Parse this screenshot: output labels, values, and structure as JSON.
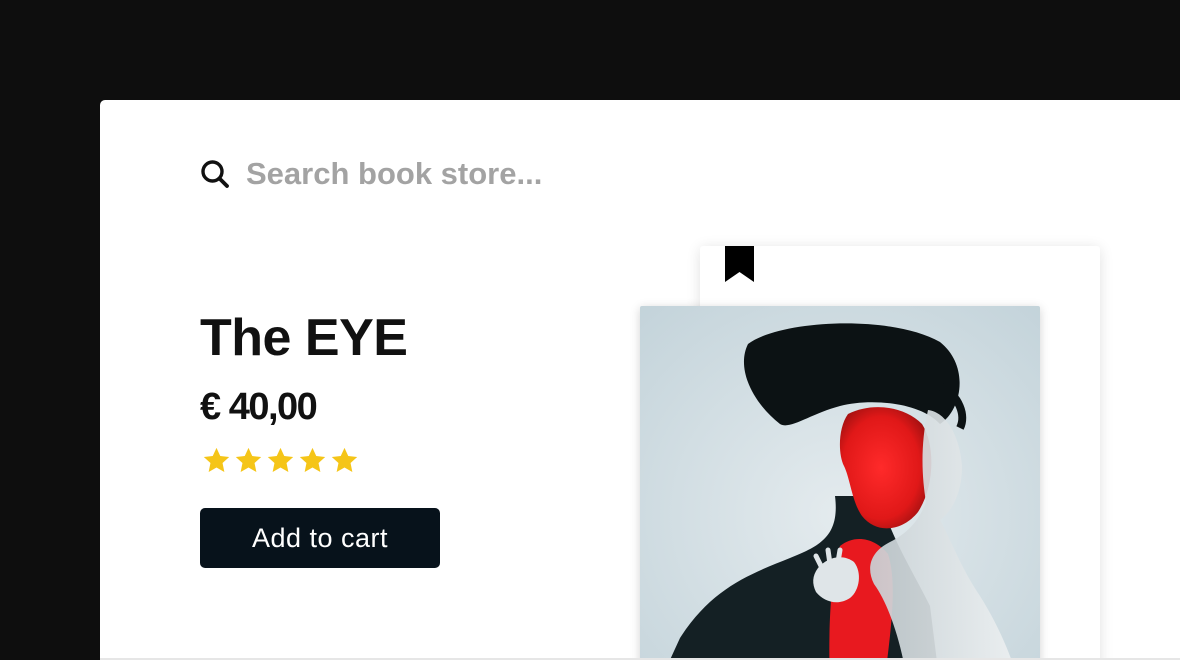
{
  "search": {
    "placeholder": "Search book store...",
    "icon": "search-icon"
  },
  "product": {
    "title": "The EYE",
    "price": "€ 40,00",
    "rating": 5,
    "rating_max": 5,
    "add_to_cart_label": "Add to cart",
    "cover_image": "portrait-cover",
    "bookmark_icon": "bookmark-icon"
  },
  "colors": {
    "page_background": "#0e0e0e",
    "panel_background": "#ffffff",
    "button_background": "#07121b",
    "star_color": "#f5c518",
    "placeholder_color": "#a3a3a3",
    "cover_sky": "#d4e0e6"
  }
}
